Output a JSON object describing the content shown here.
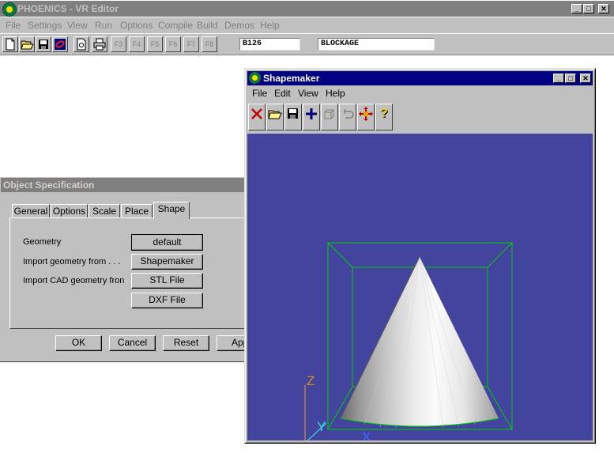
{
  "main_window": {
    "title": "PHOENICS - VR Editor",
    "menu": [
      "File",
      "Settings",
      "View",
      "Run",
      "Options",
      "Compile",
      "Build",
      "Demos",
      "Help"
    ],
    "toolbar": {
      "fkeys": [
        "F3",
        "F4",
        "F5",
        "F6",
        "F7",
        "F8"
      ],
      "object_name": "B126",
      "object_type": "BLOCKAGE"
    }
  },
  "object_spec": {
    "title": "Object Specification",
    "tabs": [
      "General",
      "Options",
      "Scale",
      "Place",
      "Shape"
    ],
    "active_tab": "Shape",
    "rows": [
      {
        "label": "Geometry",
        "button": "default"
      },
      {
        "label": "Import geometry from . . .",
        "button": "Shapemaker"
      },
      {
        "label": "Import CAD geometry fron",
        "button": "STL File"
      },
      {
        "label": "",
        "button": "DXF File"
      }
    ],
    "buttons": {
      "ok": "OK",
      "cancel": "Cancel",
      "reset": "Reset",
      "apply": "Apply"
    }
  },
  "shapemaker": {
    "title": "Shapemaker",
    "menu": [
      "File",
      "Edit",
      "View",
      "Help"
    ],
    "tools": [
      "delete-icon",
      "open-folder-icon",
      "save-icon",
      "add-icon",
      "primitive-icon",
      "undo-icon",
      "move-icon",
      "help-icon"
    ],
    "axes": {
      "x": "X",
      "y": "Y",
      "z": "Z"
    },
    "colors": {
      "viewport_bg": "#43449d",
      "bbox": "#00d000",
      "axis_x": "#3b6cff",
      "axis_y": "#3bd8d8",
      "axis_z": "#d88a2a"
    }
  }
}
